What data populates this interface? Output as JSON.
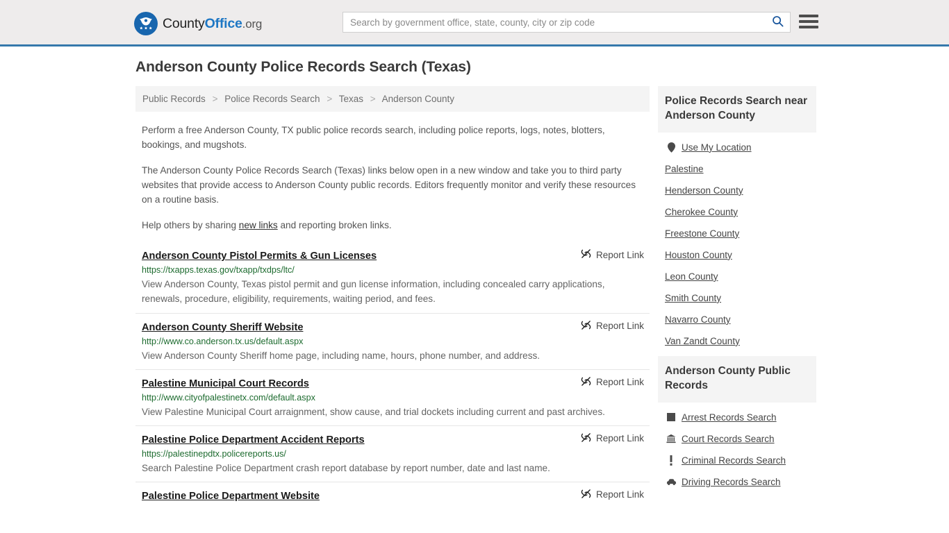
{
  "header": {
    "logo": {
      "icon": "eagle-shield-logo",
      "text_part1": "County",
      "text_part2": "Office",
      "text_part3": ".org"
    },
    "search": {
      "placeholder": "Search by government office, state, county, city or zip code",
      "value": "",
      "search_icon": "search-icon"
    },
    "menu_icon": "hamburger-menu-icon",
    "accent_color": "#3578ab",
    "background_color": "#eeecec"
  },
  "page": {
    "title": "Anderson County Police Records Search (Texas)"
  },
  "breadcrumb": {
    "separator": ">",
    "items": [
      {
        "label": "Public Records"
      },
      {
        "label": "Police Records Search"
      },
      {
        "label": "Texas"
      },
      {
        "label": "Anderson County"
      }
    ]
  },
  "intro": {
    "paragraph1": "Perform a free Anderson County, TX public police records search, including police reports, logs, notes, blotters, bookings, and mugshots.",
    "paragraph2": "The Anderson County Police Records Search (Texas) links below open in a new window and take you to third party websites that provide access to Anderson County public records. Editors frequently monitor and verify these resources on a routine basis.",
    "paragraph3_before": "Help others by sharing ",
    "paragraph3_link": "new links",
    "paragraph3_after": " and reporting broken links."
  },
  "results": {
    "report_link_label": "Report Link",
    "report_link_icon": "broken-link-icon",
    "items": [
      {
        "title": "Anderson County Pistol Permits & Gun Licenses",
        "url": "https://txapps.texas.gov/txapp/txdps/ltc/",
        "description": "View Anderson County, Texas pistol permit and gun license information, including concealed carry applications, renewals, procedure, eligibility, requirements, waiting period, and fees."
      },
      {
        "title": "Anderson County Sheriff Website",
        "url": "http://www.co.anderson.tx.us/default.aspx",
        "description": "View Anderson County Sheriff home page, including name, hours, phone number, and address."
      },
      {
        "title": "Palestine Municipal Court Records",
        "url": "http://www.cityofpalestinetx.com/default.aspx",
        "description": "View Palestine Municipal Court arraignment, show cause, and trial dockets including current and past archives."
      },
      {
        "title": "Palestine Police Department Accident Reports",
        "url": "https://palestinepdtx.policereports.us/",
        "description": "Search Palestine Police Department crash report database by report number, date and last name."
      },
      {
        "title": "Palestine Police Department Website",
        "url": "",
        "description": ""
      }
    ]
  },
  "sidebar": {
    "nearby": {
      "heading": "Police Records Search near Anderson County",
      "items": [
        {
          "label": "Use My Location",
          "icon": "map-pin-icon"
        },
        {
          "label": "Palestine",
          "icon": ""
        },
        {
          "label": "Henderson County",
          "icon": ""
        },
        {
          "label": "Cherokee County",
          "icon": ""
        },
        {
          "label": "Freestone County",
          "icon": ""
        },
        {
          "label": "Houston County",
          "icon": ""
        },
        {
          "label": "Leon County",
          "icon": ""
        },
        {
          "label": "Smith County",
          "icon": ""
        },
        {
          "label": "Navarro County",
          "icon": ""
        },
        {
          "label": "Van Zandt County",
          "icon": ""
        }
      ]
    },
    "public_records": {
      "heading": "Anderson County Public Records",
      "items": [
        {
          "label": "Arrest Records Search",
          "icon": "fingerprint-square-icon"
        },
        {
          "label": "Court Records Search",
          "icon": "courthouse-icon"
        },
        {
          "label": "Criminal Records Search",
          "icon": "exclamation-icon"
        },
        {
          "label": "Driving Records Search",
          "icon": "car-icon"
        }
      ]
    }
  }
}
